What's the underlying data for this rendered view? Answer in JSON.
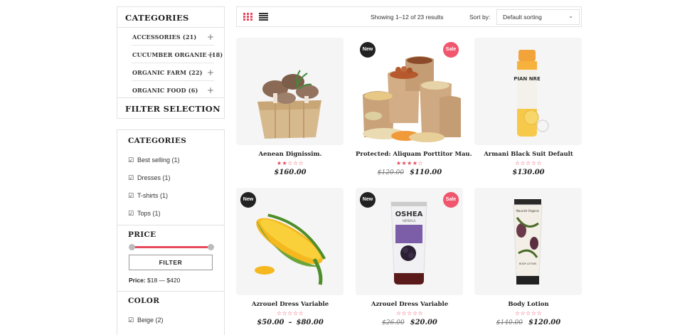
{
  "sidebar": {
    "categories_title": "CATEGORIES",
    "categories": [
      {
        "label": "ACCESSORIES (21)"
      },
      {
        "label": "CUCUMBER ORGANIE (18)"
      },
      {
        "label": "ORGANIC FARM (22)"
      },
      {
        "label": "ORGANIC FOOD (6)"
      }
    ],
    "filter_selection_title": "FILTER SELECTION",
    "filter_categories_title": "CATEGORIES",
    "filter_categories": [
      {
        "label": "Best selling (1)"
      },
      {
        "label": "Dresses (1)"
      },
      {
        "label": "T-shirts (1)"
      },
      {
        "label": "Tops (1)"
      }
    ],
    "price_title": "PRICE",
    "price_range": {
      "min": 18,
      "max": 420
    },
    "filter_button": "FILTER",
    "price_label": "Price:",
    "price_value": "$18 — $420",
    "color_title": "COLOR",
    "colors": [
      {
        "label": "Beige (2)"
      }
    ]
  },
  "toolbar": {
    "showing": "Showing 1–12 of 23 results",
    "sort_label": "Sort by:",
    "sort_value": "Default sorting"
  },
  "products": [
    {
      "name": "Aenean Dignissim.",
      "rating": 2,
      "old_price": "",
      "price": "$160.00",
      "badges": []
    },
    {
      "name": "Protected: Aliquam Porttitor Mau.",
      "rating": 4,
      "old_price": "$120.00",
      "price": "$110.00",
      "badges": [
        "New",
        "Sale"
      ]
    },
    {
      "name": "Armani Black Suit Default",
      "rating": 0,
      "old_price": "",
      "price": "$130.00",
      "badges": []
    },
    {
      "name": "Azrouel Dress Variable",
      "rating": 0,
      "old_price": "",
      "price": "$50.00",
      "price_max": "$80.00",
      "badges": [
        "New"
      ]
    },
    {
      "name": "Azrouel Dress Variable",
      "rating": 0,
      "old_price": "$26.00",
      "price": "$20.00",
      "badges": [
        "New",
        "Sale"
      ]
    },
    {
      "name": "Body Lotion",
      "rating": 0,
      "old_price": "$140.00",
      "price": "$120.00",
      "badges": []
    }
  ],
  "product_labels": {
    "p5_brand": "OSHEA",
    "p5_sub": "HERBALS",
    "p3_brand": "PIAN NRE",
    "p6_brand": "Nourish Organic",
    "p6_sub": "BODY LOTION"
  },
  "colors": {
    "accent": "#e8495d",
    "new_badge": "#222222",
    "sale_badge": "#f0566d"
  }
}
